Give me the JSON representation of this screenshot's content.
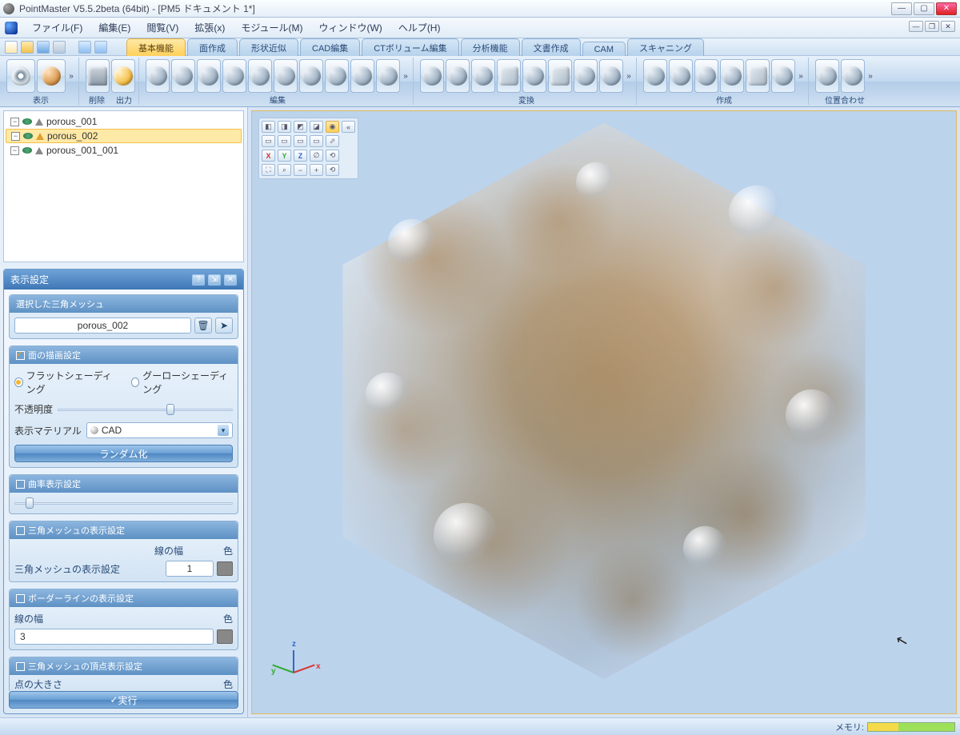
{
  "window": {
    "title": "PointMaster V5.5.2beta (64bit) - [PM5  ドキュメント 1*]"
  },
  "menu": {
    "items": [
      "ファイル(F)",
      "編集(E)",
      "閲覧(V)",
      "拡張(x)",
      "モジュール(M)",
      "ウィンドウ(W)",
      "ヘルプ(H)"
    ]
  },
  "ribbon": {
    "tabs": [
      "基本機能",
      "面作成",
      "形状近似",
      "CAD編集",
      "CTボリューム編集",
      "分析機能",
      "文書作成",
      "CAM",
      "スキャニング"
    ],
    "active_tab_index": 0,
    "groups": {
      "display": "表示",
      "delete": "削除",
      "output": "出力",
      "edit": "編集",
      "convert": "変換",
      "create": "作成",
      "align": "位置合わせ"
    }
  },
  "tree": {
    "items": [
      {
        "name": "porous_001",
        "selected": false
      },
      {
        "name": "porous_002",
        "selected": true
      },
      {
        "name": "porous_001_001",
        "selected": false
      }
    ]
  },
  "panel": {
    "title": "表示設定",
    "selected_mesh": {
      "title": "選択した三角メッシュ",
      "value": "porous_002"
    },
    "surface": {
      "title": "面の描画設定",
      "shading_flat": "フラットシェーディング",
      "shading_gouraud": "グーローシェーディング",
      "opacity_label": "不透明度",
      "opacity_percent": 62,
      "material_label": "表示マテリアル",
      "material_value": "CAD",
      "randomize": "ランダム化"
    },
    "curvature": {
      "title": "曲率表示設定",
      "percent": 5
    },
    "mesh_display": {
      "title": "三角メッシュの表示設定",
      "width_label": "線の幅",
      "color_label": "色",
      "row_label": "三角メッシュの表示設定",
      "width_value": "1"
    },
    "borderline": {
      "title": "ボーダーラインの表示設定",
      "width_label": "線の幅",
      "color_label": "色",
      "width_value": "3"
    },
    "vertex": {
      "title": "三角メッシュの頂点表示設定",
      "sublabel": "点の大きさ",
      "color_label": "色"
    },
    "execute": "実行"
  },
  "viewport": {
    "axes": {
      "x": "x",
      "y": "y",
      "z": "z"
    }
  },
  "statusbar": {
    "memory_label": "メモリ:"
  }
}
